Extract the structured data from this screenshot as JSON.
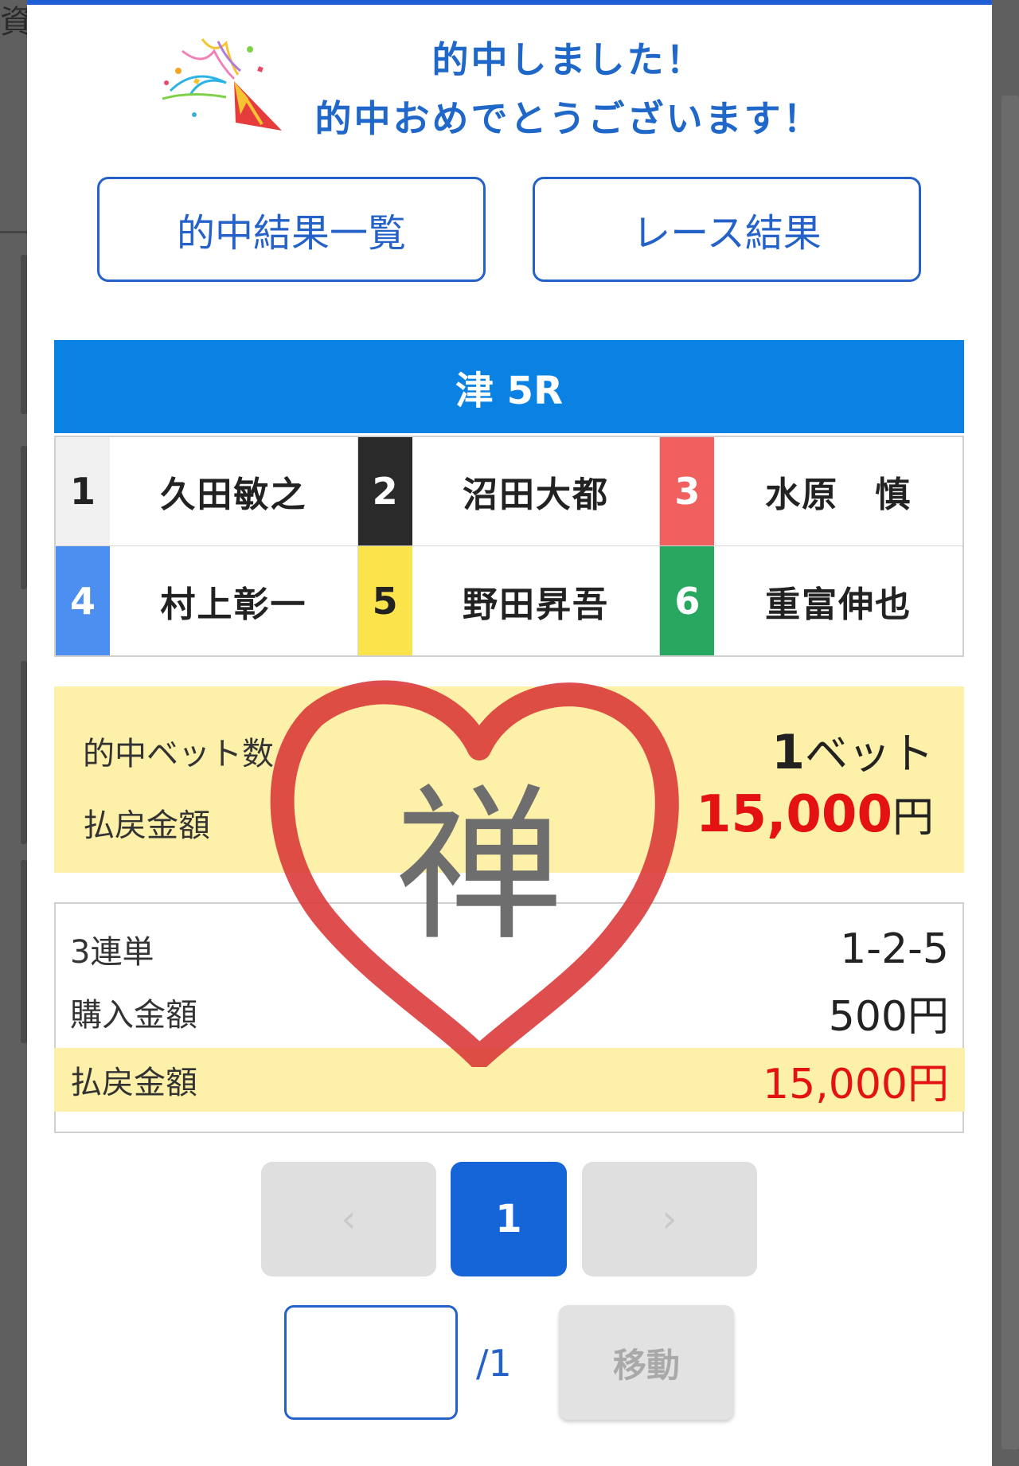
{
  "background": {
    "partial_text": "資金"
  },
  "modal": {
    "headline_line1": "的中しました！",
    "headline_line2": "的中おめでとうございます！",
    "buttons": {
      "hit_results": "的中結果一覧",
      "race_results": "レース結果"
    }
  },
  "race": {
    "title": "津 5R",
    "racers": [
      {
        "lane": "1",
        "name": "久田敏之",
        "lane_bg": "#f0f0f0",
        "lane_fg": "#222222"
      },
      {
        "lane": "2",
        "name": "沼田大都",
        "lane_bg": "#2a2a2a",
        "lane_fg": "#ffffff"
      },
      {
        "lane": "3",
        "name": "水原　慎",
        "lane_bg": "#f0605e",
        "lane_fg": "#ffffff"
      },
      {
        "lane": "4",
        "name": "村上彰一",
        "lane_bg": "#4d8ff0",
        "lane_fg": "#ffffff"
      },
      {
        "lane": "5",
        "name": "野田昇吾",
        "lane_bg": "#fbe34b",
        "lane_fg": "#222222"
      },
      {
        "lane": "6",
        "name": "重富伸也",
        "lane_bg": "#28a761",
        "lane_fg": "#ffffff"
      }
    ]
  },
  "summary": {
    "hit_bets_label": "的中ベット数",
    "hit_bets_number": "1",
    "hit_bets_unit": "ベット",
    "payout_label": "払戻金額",
    "payout_amount": "15,000",
    "payout_unit": "円"
  },
  "bet": {
    "type_label": "3連単",
    "combination": "1-2-5",
    "purchase_label": "購入金額",
    "purchase_amount": "500円",
    "payout_label": "払戻金額",
    "payout_amount": "15,000円"
  },
  "pagination": {
    "prev_symbol": "‹",
    "current_page": "1",
    "next_symbol": "›",
    "input_value": "",
    "total_label": "/1",
    "move_label": "移動"
  },
  "stamp": {
    "character": "禅"
  },
  "colors": {
    "accent": "#1f67c8",
    "race_header": "#0a82e4",
    "highlight_bg": "#fdf0a8",
    "payout_red": "#e41212",
    "heart_red": "#d93535"
  },
  "icons": {
    "confetti": "party-popper-icon"
  }
}
